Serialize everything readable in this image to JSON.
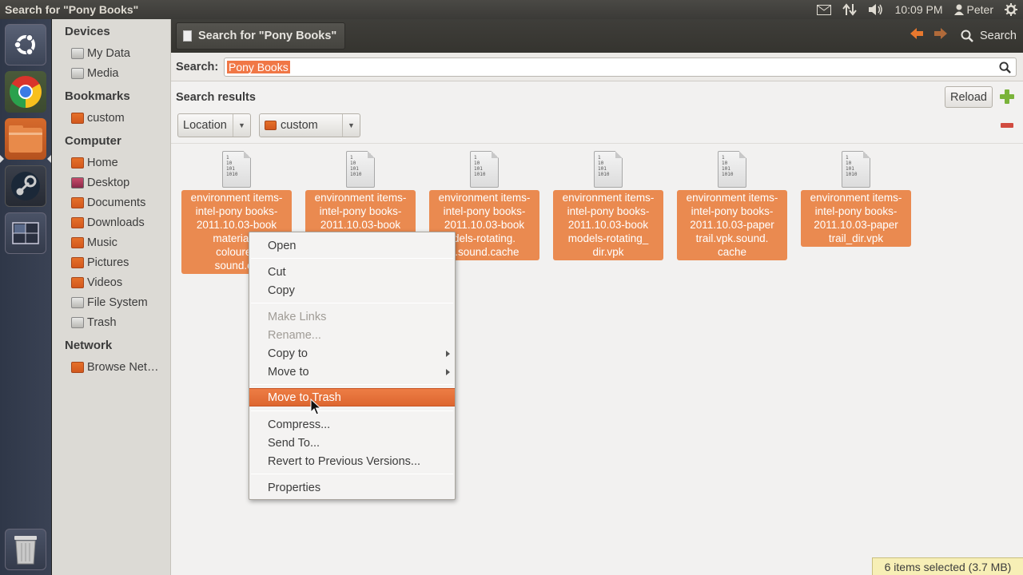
{
  "top_panel": {
    "window_title": "Search for \"Pony Books\"",
    "clock": "10:09 PM",
    "user": "Peter"
  },
  "launcher": {
    "items": [
      "dash-home",
      "chrome",
      "files",
      "steam",
      "workspace-switcher",
      "trash"
    ]
  },
  "sidebar": {
    "devices_heading": "Devices",
    "devices": [
      "My Data",
      "Media"
    ],
    "bookmarks_heading": "Bookmarks",
    "bookmarks": [
      "custom"
    ],
    "computer_heading": "Computer",
    "computer": [
      "Home",
      "Desktop",
      "Documents",
      "Downloads",
      "Music",
      "Pictures",
      "Videos",
      "File System",
      "Trash"
    ],
    "network_heading": "Network",
    "network": [
      "Browse Net…"
    ]
  },
  "toolbar": {
    "path_button": "Search for \"Pony Books\"",
    "search_label": "Search"
  },
  "search": {
    "label": "Search:",
    "value": "Pony Books"
  },
  "results": {
    "title": "Search results",
    "reload": "Reload",
    "criteria_type": "Location",
    "criteria_value": "custom"
  },
  "files": [
    {
      "lines": [
        "environment items-",
        "intel-pony books-",
        "2011.10.03-book",
        "materials-",
        "coloured",
        "sound.ca"
      ]
    },
    {
      "lines": [
        "environment items-",
        "intel-pony books-",
        "2011.10.03-book",
        ""
      ]
    },
    {
      "lines": [
        "environment items-",
        "intel-pony books-",
        "2011.10.03-book",
        "dels-rotating.",
        "k.sound.cache"
      ]
    },
    {
      "lines": [
        "environment items-",
        "intel-pony books-",
        "2011.10.03-book",
        "models-rotating_",
        "dir.vpk"
      ]
    },
    {
      "lines": [
        "environment items-",
        "intel-pony books-",
        "2011.10.03-paper",
        "trail.vpk.sound.",
        "cache"
      ]
    },
    {
      "lines": [
        "environment items-",
        "intel-pony books-",
        "2011.10.03-paper",
        "trail_dir.vpk"
      ]
    }
  ],
  "icon_text": [
    "1",
    "10",
    "101",
    "1010"
  ],
  "context_menu": {
    "open": "Open",
    "cut": "Cut",
    "copy": "Copy",
    "make_links": "Make Links",
    "rename": "Rename...",
    "copy_to": "Copy to",
    "move_to": "Move to",
    "move_to_trash": "Move to Trash",
    "compress": "Compress...",
    "send_to": "Send To...",
    "revert": "Revert to Previous Versions...",
    "properties": "Properties"
  },
  "status": "6 items selected (3.7 MB)",
  "colors": {
    "accent": "#ea8a50",
    "highlight": "#e2703a",
    "toolbar": "#3c3b37",
    "launcher": "#323a4a"
  }
}
